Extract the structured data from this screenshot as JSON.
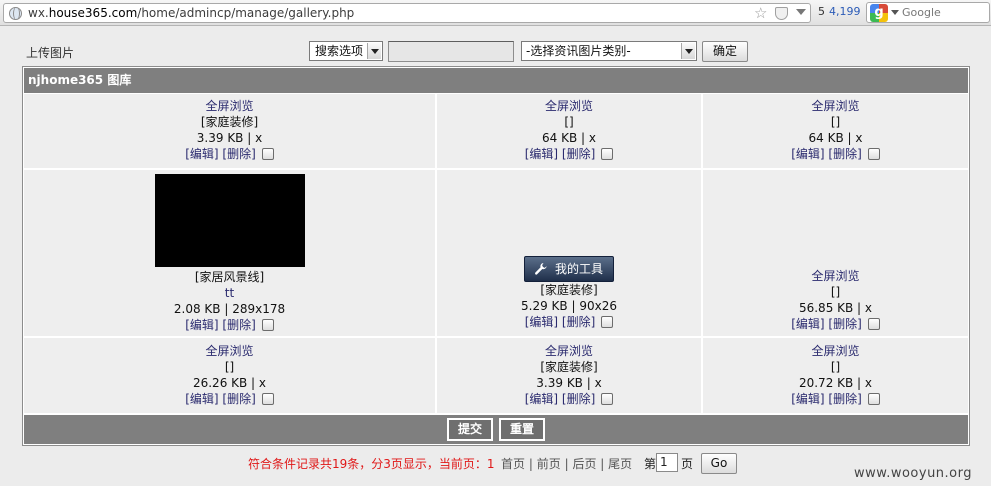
{
  "browser": {
    "url_prefix": "wx.",
    "url_domain": "house365.com",
    "url_path": "/home/admincp/manage/gallery.php",
    "pr_rank": "5",
    "alexa_count": "4,199",
    "search_engine": "Google",
    "google_letter": "g"
  },
  "toolbar": {
    "upload_label": "上传图片",
    "search_option": "搜索选项",
    "category_select": "-选择资讯图片类别-",
    "confirm_button": "确定"
  },
  "gallery": {
    "title": "njhome365 图库",
    "rows": [
      [
        {
          "fullscreen": "全屏浏览",
          "category": "[家庭装修]",
          "info": "3.39 KB | x",
          "edit": "[编辑]",
          "delete": "[删除]"
        },
        {
          "fullscreen": "全屏浏览",
          "category": "[]",
          "info": "64 KB | x",
          "edit": "[编辑]",
          "delete": "[删除]"
        },
        {
          "fullscreen": "全屏浏览",
          "category": "[]",
          "info": "64 KB | x",
          "edit": "[编辑]",
          "delete": "[删除]"
        }
      ],
      [
        {
          "category": "[家居风景线]",
          "name": "tt",
          "info": "2.08 KB | 289x178",
          "edit": "[编辑]",
          "delete": "[删除]"
        },
        {
          "tool_button": "我的工具",
          "category": "[家庭装修]",
          "info": "5.29 KB | 90x26",
          "edit": "[编辑]",
          "delete": "[删除]"
        },
        {
          "fullscreen": "全屏浏览",
          "category": "[]",
          "info": "56.85 KB | x",
          "edit": "[编辑]",
          "delete": "[删除]"
        }
      ],
      [
        {
          "fullscreen": "全屏浏览",
          "category": "[]",
          "info": "26.26 KB | x",
          "edit": "[编辑]",
          "delete": "[删除]"
        },
        {
          "fullscreen": "全屏浏览",
          "category": "[家庭装修]",
          "info": "3.39 KB | x",
          "edit": "[编辑]",
          "delete": "[删除]"
        },
        {
          "fullscreen": "全屏浏览",
          "category": "[]",
          "info": "20.72 KB | x",
          "edit": "[编辑]",
          "delete": "[删除]"
        }
      ]
    ],
    "submit_button": "提交",
    "reset_button": "重置"
  },
  "pagination": {
    "summary": "符合条件记录共19条，分3页显示，当前页：",
    "current_page": "1",
    "first": "首页",
    "prev": "前页",
    "next": "后页",
    "last": "尾页",
    "sep": "|",
    "page_prefix": "第",
    "page_input": "1",
    "page_suffix": "页",
    "go_button": "Go"
  },
  "watermark": "www.wooyun.org",
  "colors": {
    "header_bg": "#7f7f7f",
    "cell_bg": "#eeeeee",
    "summary_red": "#e01818"
  }
}
